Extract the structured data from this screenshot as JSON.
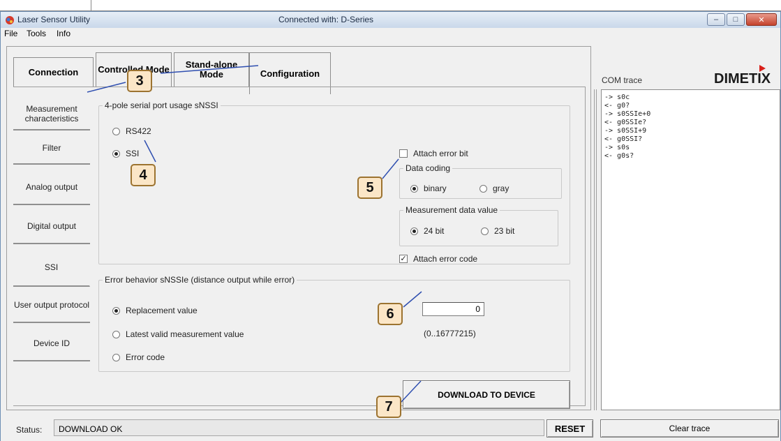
{
  "window": {
    "title": "Laser Sensor Utility",
    "connection": "Connected with: D-Series",
    "controls": {
      "minimize": "–",
      "maximize": "□",
      "close": "✕"
    }
  },
  "menu": {
    "items": [
      "File",
      "Tools",
      "Info"
    ]
  },
  "tabs": {
    "connection": "Connection",
    "controlled_mode": "Controlled Mode",
    "standalone_mode": "Stand-alone Mode",
    "configuration": "Configuration"
  },
  "side_tabs": [
    "Measurement characteristics",
    "Filter",
    "Analog output",
    "Digital output",
    "SSI",
    "User output protocol",
    "Device ID"
  ],
  "ssi_group": {
    "legend": "4-pole serial port usage sNSSI",
    "option_rs422": "RS422",
    "option_ssi": "SSI",
    "selected": "SSI",
    "attach_error_bit": "Attach error bit",
    "attach_error_bit_checked": false,
    "data_coding": {
      "legend": "Data coding",
      "binary": "binary",
      "gray": "gray",
      "selected": "binary"
    },
    "measurement_value": {
      "legend": "Measurement data value",
      "bit24": "24 bit",
      "bit23": "23 bit",
      "selected": "24 bit"
    },
    "attach_error_code": "Attach error code",
    "attach_error_code_checked": true
  },
  "error_group": {
    "legend": "Error behavior sNSSIe (distance output while error)",
    "replacement": "Replacement value",
    "latest": "Latest valid measurement value",
    "error_code": "Error code",
    "selected": "Replacement value",
    "value": "0",
    "range": "(0..16777215)"
  },
  "download_button": "DOWNLOAD TO DEVICE",
  "status": {
    "label": "Status:",
    "text": "DOWNLOAD OK"
  },
  "reset_button": "RESET",
  "com_trace": {
    "title": "COM trace",
    "lines": [
      "-> s0c",
      "<- g0?",
      "-> s0SSIe+0",
      "<- g0SSIe?",
      "-> s0SSI+9",
      "<- g0SSI?",
      "-> s0s",
      "<- g0s?"
    ],
    "clear_button": "Clear trace"
  },
  "logo": "DIMETIX",
  "callouts": [
    "3",
    "4",
    "5",
    "6",
    "7"
  ],
  "colors": {
    "callout_fill": "#fbe6c7",
    "callout_border": "#9c7330",
    "arrow": "#2f4fb0",
    "logo_accent": "#d9201a"
  }
}
